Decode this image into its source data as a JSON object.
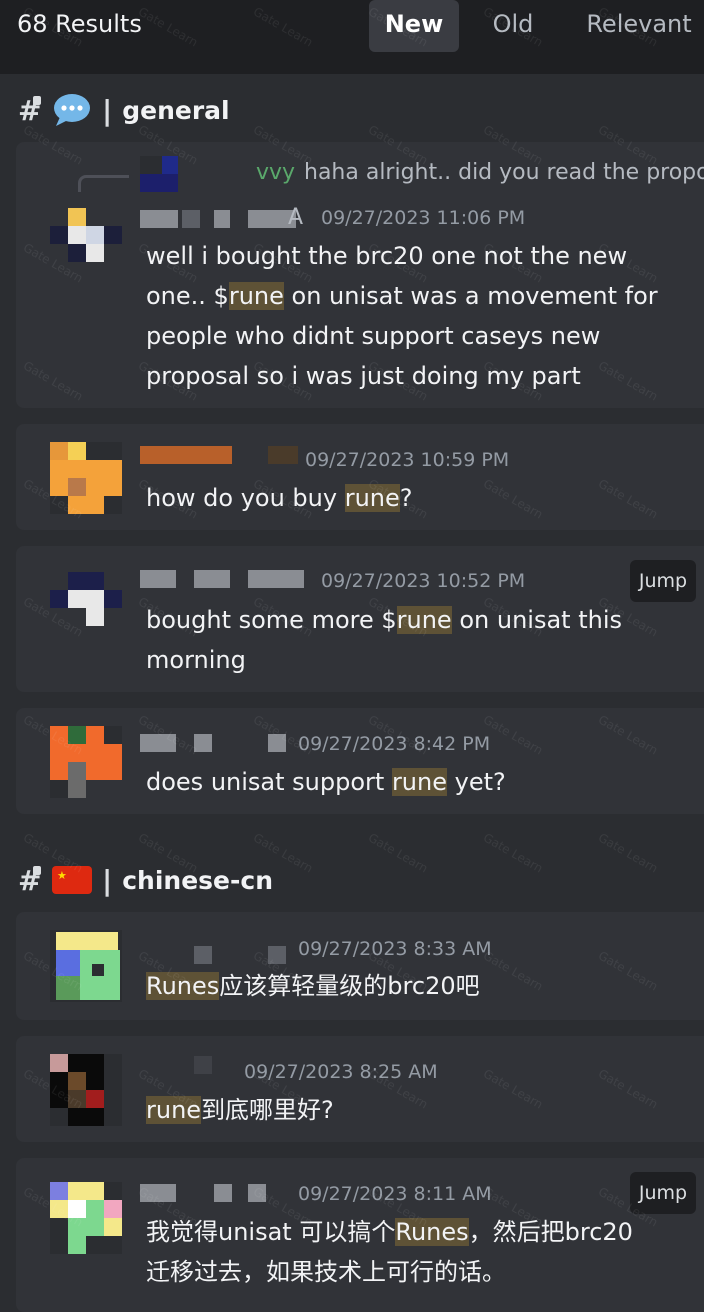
{
  "header": {
    "results_count": "68 Results",
    "tabs": [
      {
        "label": "New",
        "active": true
      },
      {
        "label": "Old",
        "active": false
      },
      {
        "label": "Relevant",
        "active": false
      }
    ]
  },
  "channels": [
    {
      "name": "general",
      "emoji": "speech-bubble-icon",
      "separator": "|"
    },
    {
      "name": "chinese-cn",
      "emoji": "china-flag-icon",
      "separator": "|"
    }
  ],
  "messages": {
    "m1": {
      "reply_author": "vvy",
      "reply_text": "haha alright.. did you read the propo",
      "author_suffix": "A",
      "timestamp": "09/27/2023 11:06 PM",
      "text_parts": [
        "well i bought the brc20 one not the new one.. $",
        "rune",
        " on unisat was a movement for people who didnt support caseys new proposal so i was just doing my part"
      ]
    },
    "m2": {
      "timestamp": "09/27/2023 10:59 PM",
      "text_parts": [
        "how do you buy ",
        "rune",
        "?"
      ]
    },
    "m3": {
      "timestamp": "09/27/2023 10:52 PM",
      "jump_label": "Jump",
      "text_parts": [
        "bought some more $",
        "rune",
        " on unisat this morning"
      ]
    },
    "m4": {
      "timestamp": "09/27/2023 8:42 PM",
      "text_parts": [
        "does unisat support ",
        "rune",
        " yet?"
      ]
    },
    "m5": {
      "timestamp": "09/27/2023 8:33 AM",
      "text_parts": [
        "",
        "Runes",
        "应该算轻量级的brc20吧"
      ]
    },
    "m6": {
      "timestamp": "09/27/2023 8:25 AM",
      "text_parts": [
        "",
        "rune",
        "到底哪里好?"
      ]
    },
    "m7": {
      "timestamp": "09/27/2023 8:11 AM",
      "jump_label": "Jump",
      "text_parts": [
        "我觉得unisat 可以搞个",
        "Runes",
        "，然后把brc20迁移过去，如果技术上可行的话。"
      ]
    }
  },
  "watermark_text": "Gate Learn",
  "colors": {
    "background": "#2b2d31",
    "card": "#313338",
    "topbar": "#1e1f22",
    "highlight": "#5e5236",
    "timestamp": "#949ba4",
    "reply_author": "#5aa86b"
  }
}
